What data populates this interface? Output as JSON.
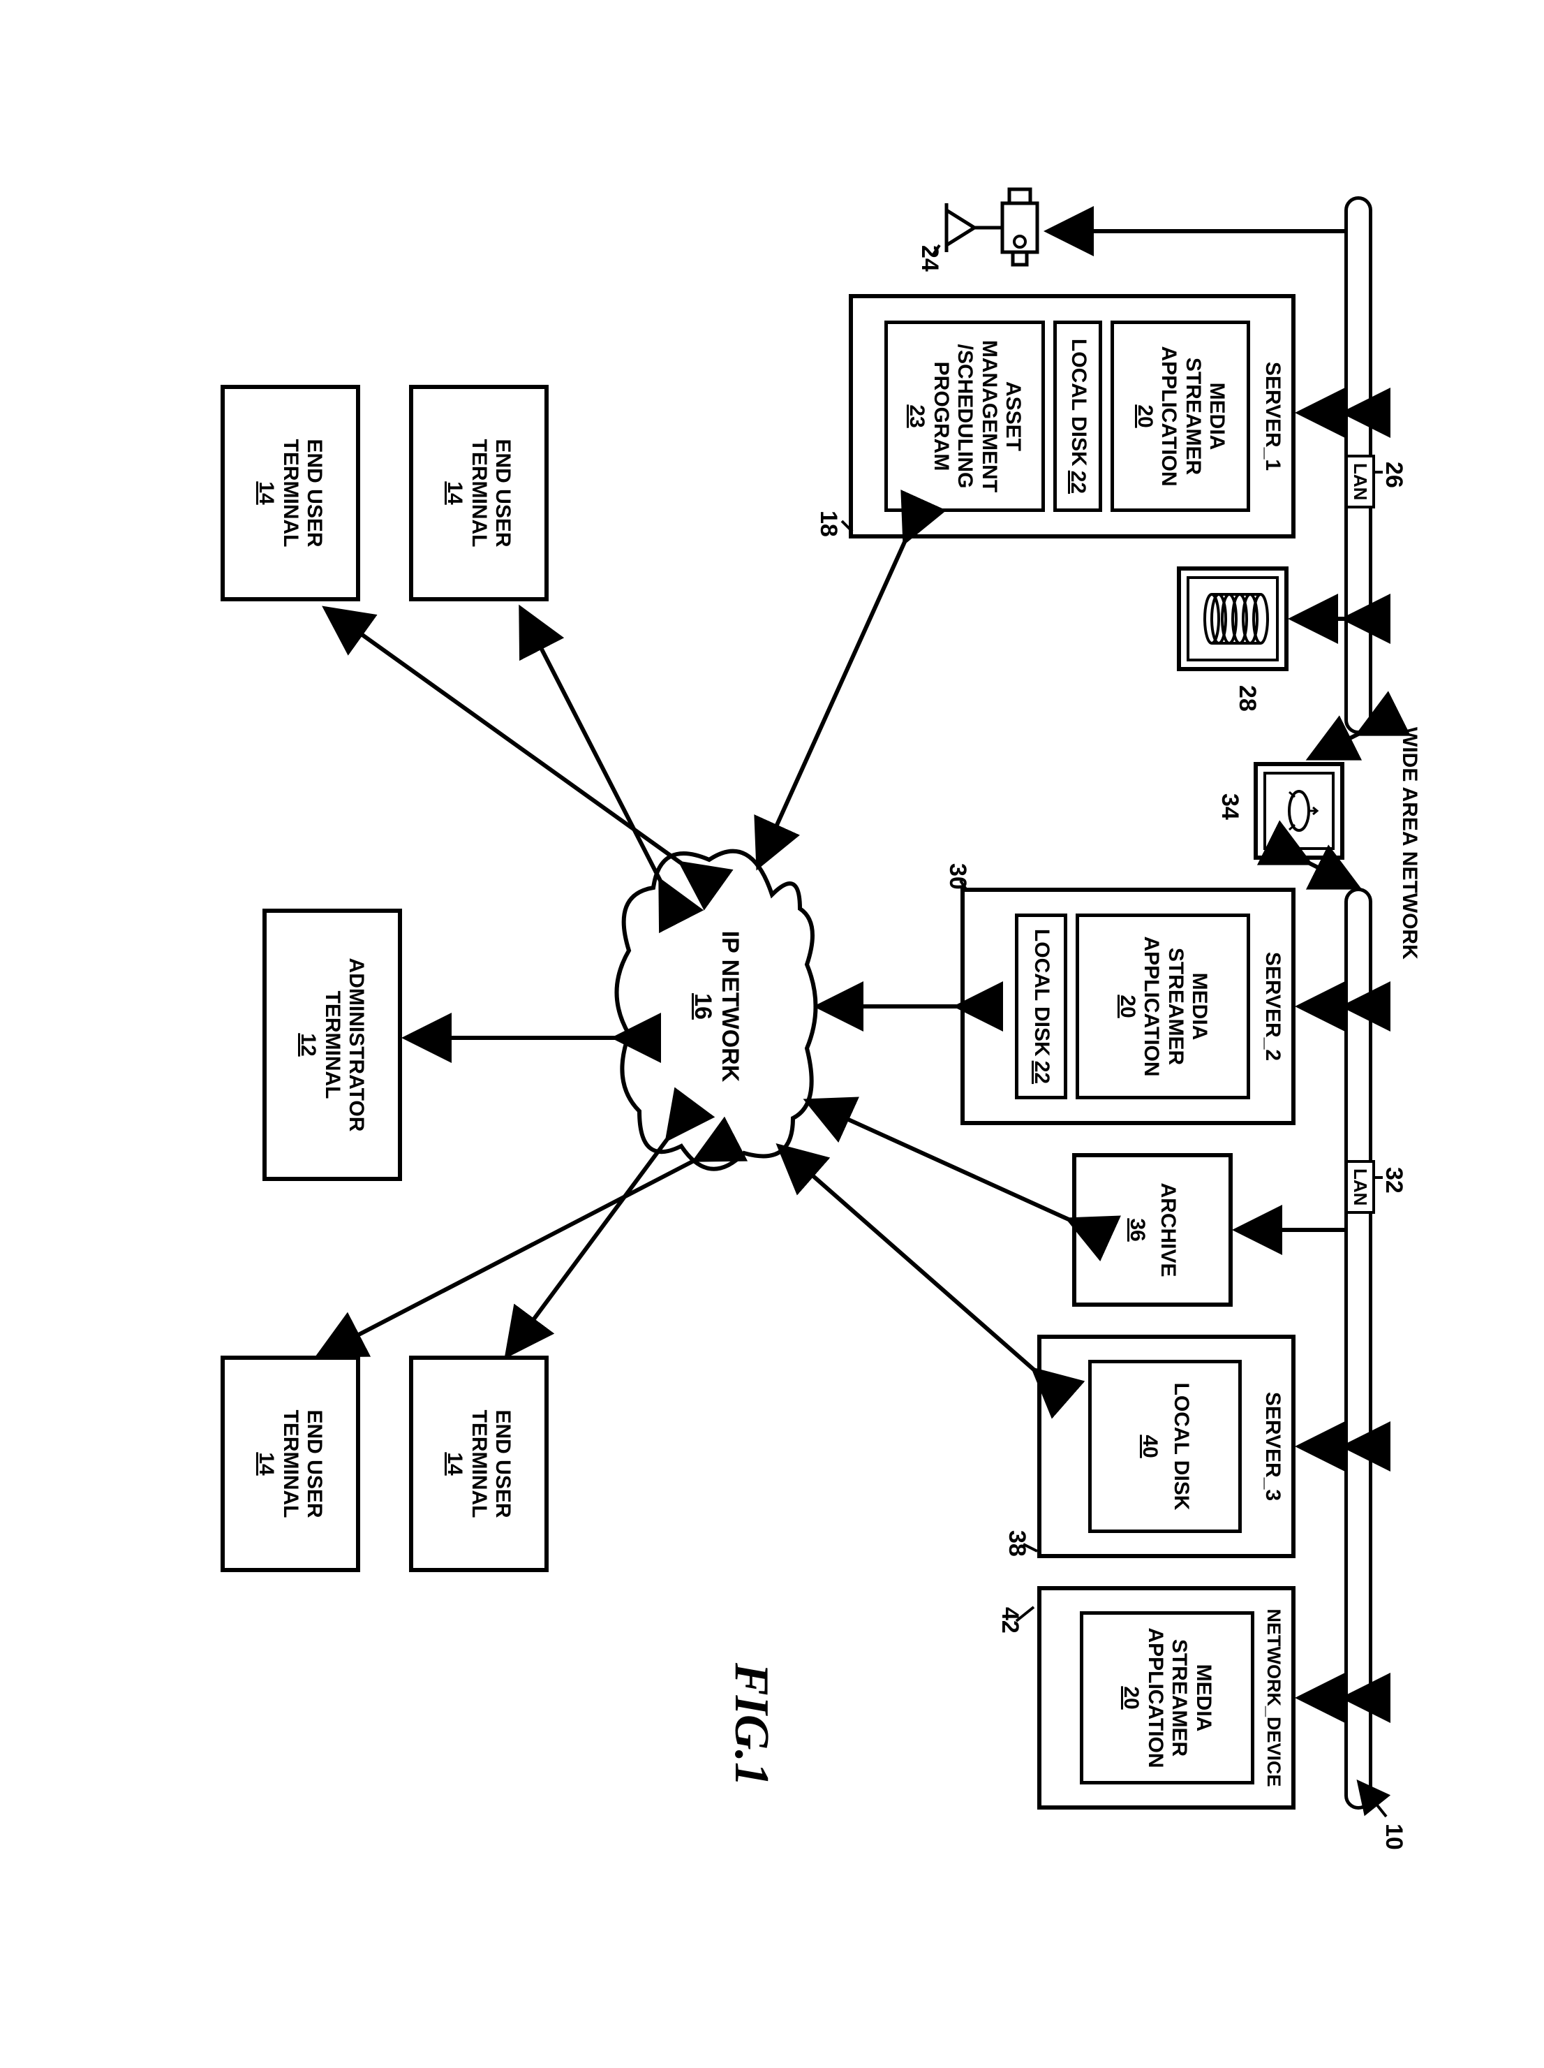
{
  "figure_label": "FIG.1",
  "system_ref": "10",
  "wan_label": "WIDE AREA NETWORK",
  "lan1": {
    "tag": "LAN",
    "ref": "26"
  },
  "lan2": {
    "tag": "LAN",
    "ref": "32"
  },
  "camera_ref": "24",
  "disk_stack_ref": "28",
  "router_ref": "34",
  "server1": {
    "title": "SERVER_1",
    "ref": "18",
    "media_app": {
      "label": "MEDIA STREAMER APPLICATION",
      "num": "20"
    },
    "local_disk": {
      "label": "LOCAL DISK",
      "num": "22"
    },
    "asset_mgmt": {
      "label": "ASSET MANAGEMENT /SCHEDULING PROGRAM",
      "num": "23"
    }
  },
  "server2": {
    "title": "SERVER_2",
    "ref": "30",
    "media_app": {
      "label": "MEDIA STREAMER APPLICATION",
      "num": "20"
    },
    "local_disk": {
      "label": "LOCAL DISK",
      "num": "22"
    }
  },
  "archive": {
    "label": "ARCHIVE",
    "num": "36"
  },
  "server3": {
    "title": "SERVER_3",
    "ref": "38",
    "local_disk": {
      "label": "LOCAL DISK",
      "num": "40"
    }
  },
  "net_device": {
    "title": "NETWORK_DEVICE",
    "ref": "42",
    "media_app": {
      "label": "MEDIA STREAMER APPLICATION",
      "num": "20"
    }
  },
  "ip_network": {
    "label": "IP NETWORK",
    "num": "16"
  },
  "end_user": {
    "label": "END USER TERMINAL",
    "num": "14"
  },
  "admin": {
    "label": "ADMINISTRATOR TERMINAL",
    "num": "12"
  }
}
